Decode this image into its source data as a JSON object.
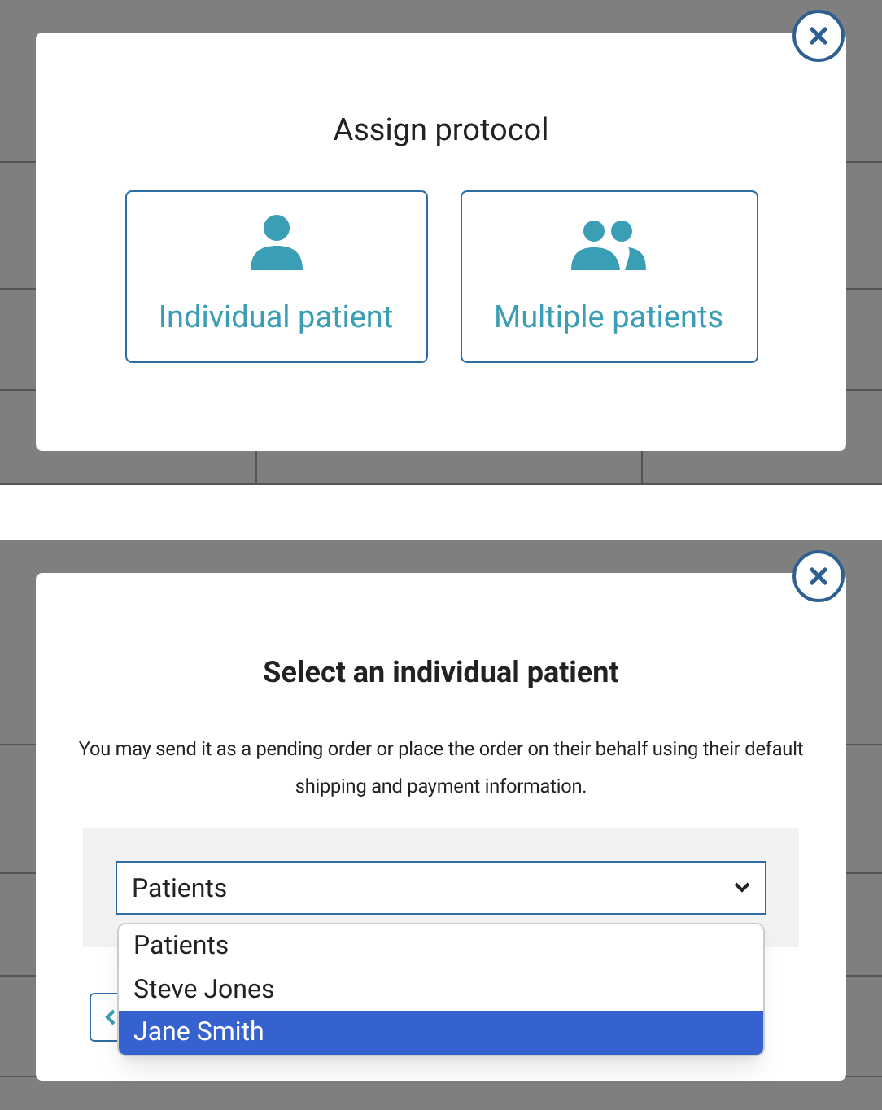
{
  "assign_panel": {
    "title": "Assign protocol",
    "options": [
      {
        "label": "Individual patient",
        "kind": "single"
      },
      {
        "label": "Multiple patients",
        "kind": "group"
      }
    ]
  },
  "patient_panel": {
    "title": "Select an individual patient",
    "description": "You may send it as a pending order or place the order on their behalf using their default shipping and payment information.",
    "select": {
      "value": "Patients",
      "expanded": true
    },
    "select_options": [
      {
        "label": "Patients",
        "selected": false
      },
      {
        "label": "Steve Jones",
        "selected": false
      },
      {
        "label": "Jane Smith",
        "selected": true
      }
    ]
  }
}
